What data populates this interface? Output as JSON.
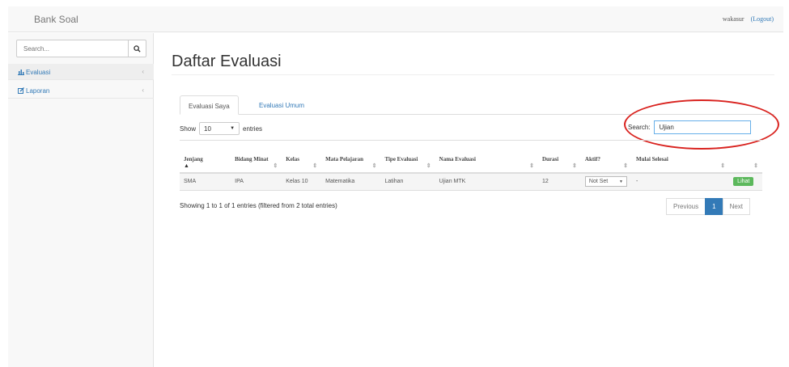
{
  "navbar": {
    "brand": "Bank Soal",
    "user": "wakasur",
    "logout": "(Logout)"
  },
  "sidebar": {
    "search_placeholder": "Search...",
    "items": [
      {
        "label": "Evaluasi",
        "icon": "bar-chart-icon",
        "active": true
      },
      {
        "label": "Laporan",
        "icon": "edit-icon",
        "active": false
      }
    ]
  },
  "page": {
    "title": "Daftar Evaluasi"
  },
  "tabs": [
    {
      "label": "Evaluasi Saya"
    },
    {
      "label": "Evaluasi Umum"
    }
  ],
  "length_control": {
    "show_label": "Show",
    "value": "10",
    "entries_label": "entries"
  },
  "filter": {
    "label": "Search:",
    "value": "Ujian"
  },
  "table": {
    "headers": [
      "Jenjang",
      "Bidang Minat",
      "Kelas",
      "Mata Pelajaran",
      "Tipe Evaluasi",
      "Nama Evaluasi",
      "Durasi",
      "Aktif?",
      "Mulai Selesai",
      ""
    ],
    "rows": [
      [
        "SMA",
        "IPA",
        "Kelas 10",
        "Matematika",
        "Latihan",
        "Ujian MTK",
        "12",
        "Not Set",
        "-",
        "Lihat"
      ]
    ]
  },
  "info": "Showing 1 to 1 of 1 entries (filtered from 2 total entries)",
  "pagination": {
    "previous": "Previous",
    "current": "1",
    "next": "Next"
  },
  "colors": {
    "link": "#337ab7",
    "success": "#5cb85c",
    "highlight_ellipse": "#d9231f"
  }
}
